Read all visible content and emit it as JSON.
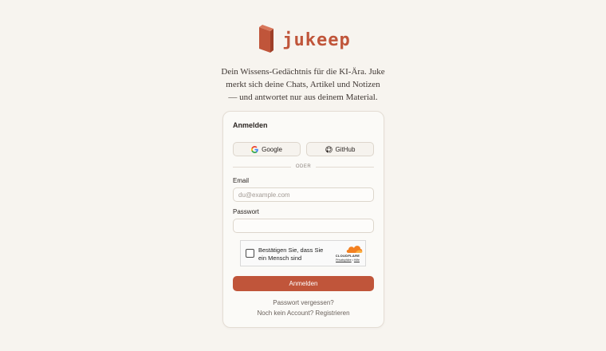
{
  "brand": {
    "name": "jukeep",
    "logo_icon": "book-icon",
    "accent": "#c0553a"
  },
  "tagline": {
    "line1": "Dein Wissens-Gedächtnis für die KI-Ära. Juke",
    "line2": "merkt sich deine Chats, Artikel und Notizen",
    "line3": "— und antwortet nur aus deinem Material."
  },
  "login": {
    "title": "Anmelden",
    "google_label": "Google",
    "github_label": "GitHub",
    "divider": "ODER",
    "email_label": "Email",
    "email_placeholder": "du@example.com",
    "email_value": "",
    "password_label": "Passwort",
    "password_value": "",
    "submit_label": "Anmelden",
    "forgot_label": "Passwort vergessen?",
    "register_label": "Noch kein Account? Registrieren"
  },
  "captcha": {
    "text": "Bestätigen Sie, dass Sie ein Mensch sind",
    "brand": "CLOUDFLARE",
    "privacy_label": "Privatsphäre",
    "separator": "•",
    "help_label": "Hilfe"
  }
}
